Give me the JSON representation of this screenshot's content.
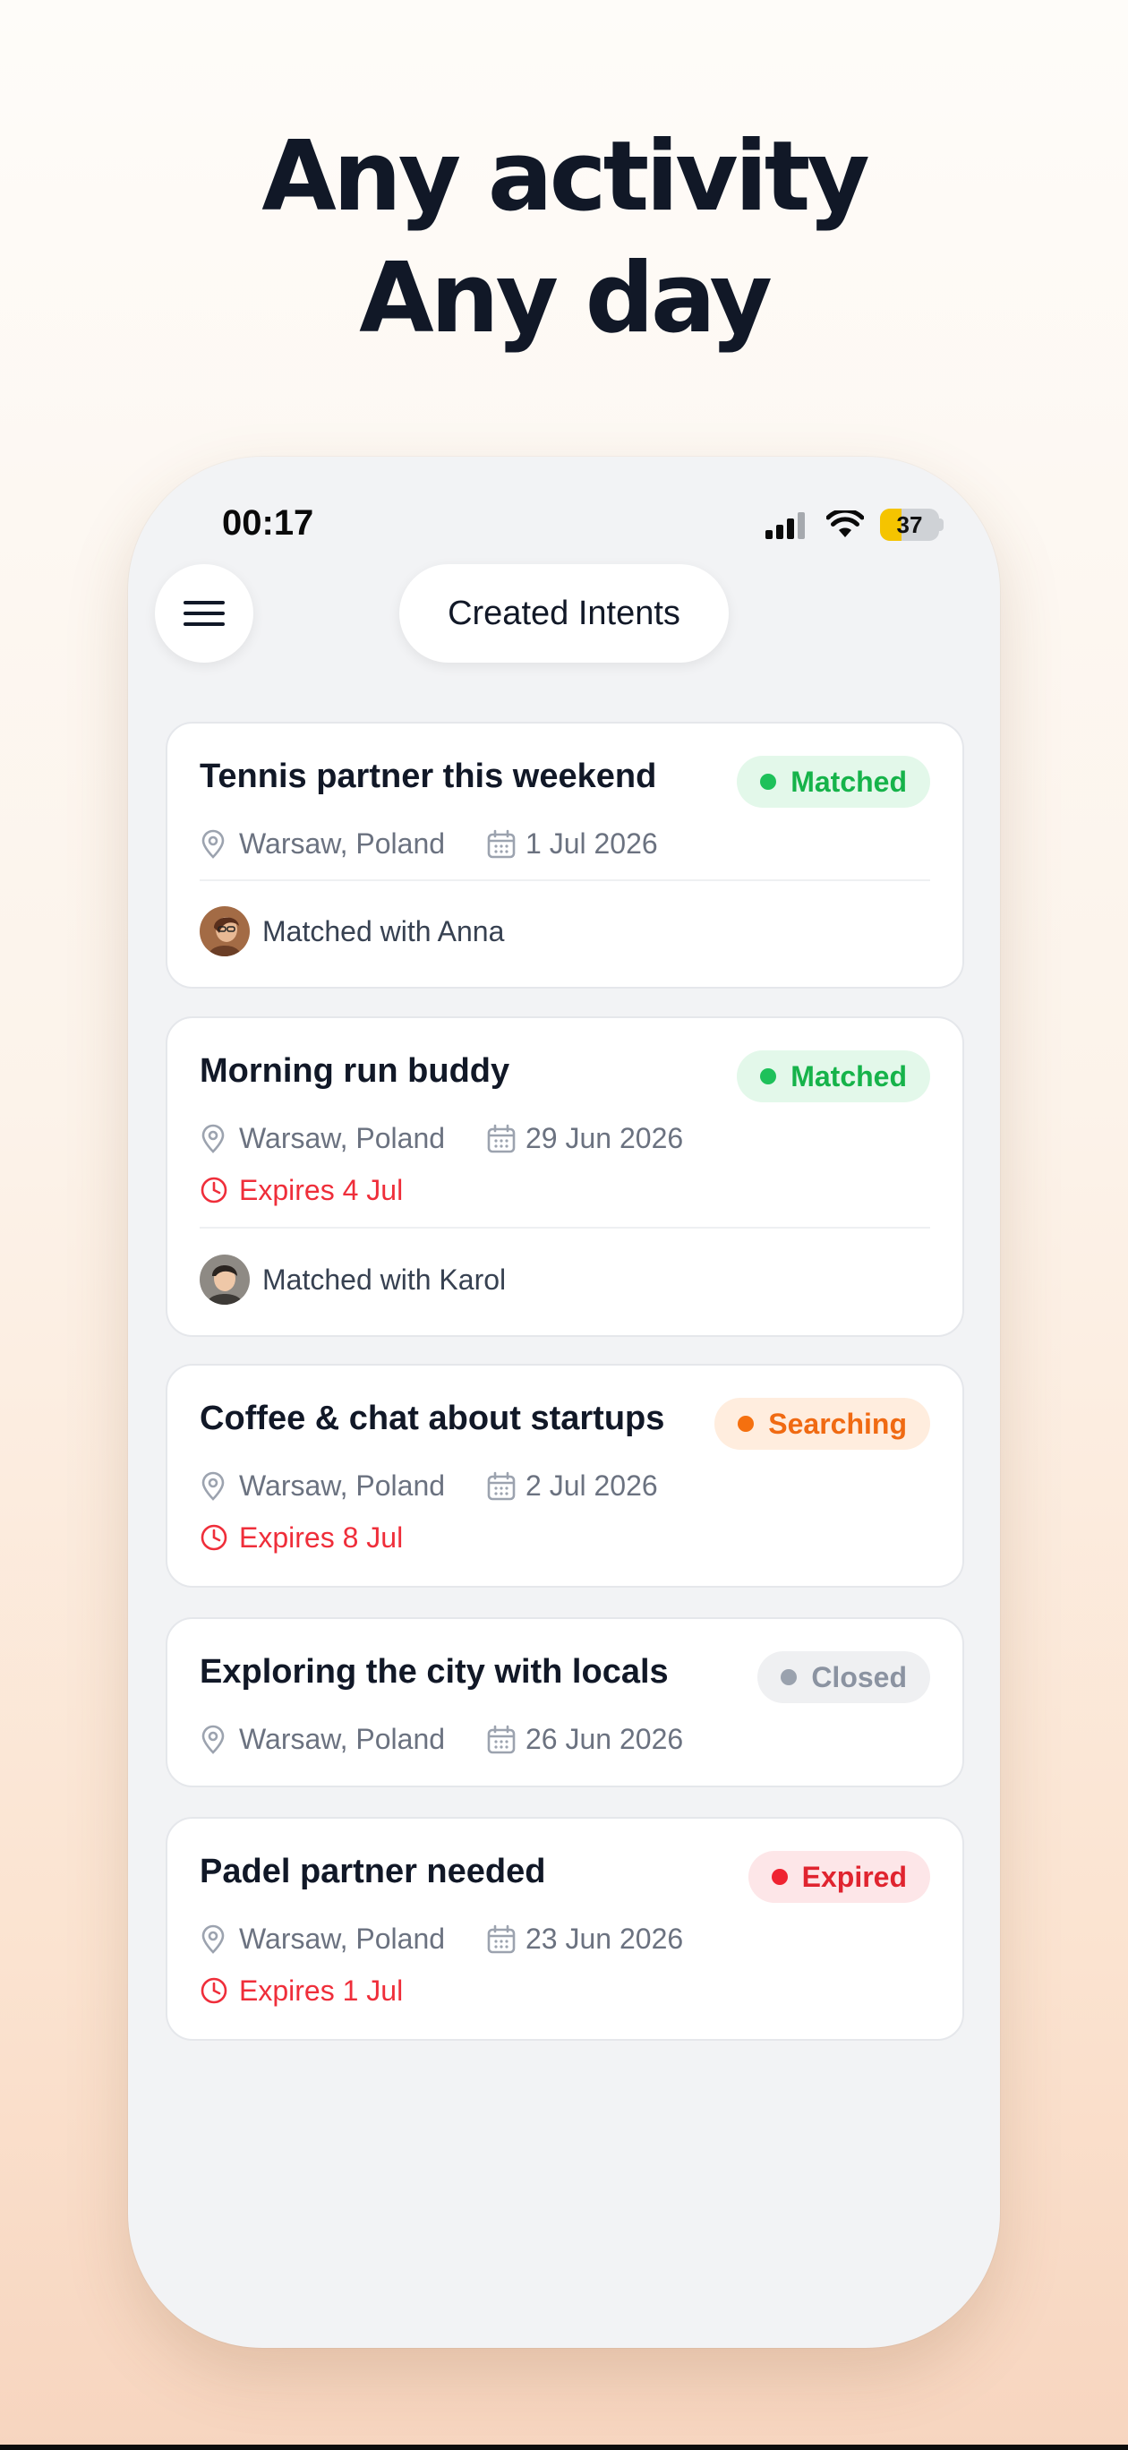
{
  "hero": {
    "line1": "Any activity",
    "line2": "Any day"
  },
  "status_bar": {
    "time": "00:17",
    "battery": "37",
    "battery_level": 0.37
  },
  "header": {
    "menu_icon": "hamburger-icon",
    "title": "Created Intents"
  },
  "intents": [
    {
      "title": "Tennis partner this weekend",
      "status": "Matched",
      "location": "Warsaw, Poland",
      "date": "1 Jul 2026",
      "expires": "",
      "matched_with": "Matched with Anna"
    },
    {
      "title": "Morning run buddy",
      "status": "Matched",
      "location": "Warsaw, Poland",
      "date": "29 Jun 2026",
      "expires": "Expires 4 Jul",
      "matched_with": "Matched with Karol"
    },
    {
      "title": "Coffee & chat about startups",
      "status": "Searching",
      "location": "Warsaw, Poland",
      "date": "2 Jul 2026",
      "expires": "Expires 8 Jul",
      "matched_with": ""
    },
    {
      "title": "Exploring the city with locals",
      "status": "Closed",
      "location": "Warsaw, Poland",
      "date": "26 Jun 2026",
      "expires": "",
      "matched_with": ""
    },
    {
      "title": "Padel partner needed",
      "status": "Expired",
      "location": "Warsaw, Poland",
      "date": "23 Jun 2026",
      "expires": "Expires 1 Jul",
      "matched_with": ""
    }
  ],
  "colors": {
    "matched": "#16b34a",
    "searching": "#f06a12",
    "closed": "#8b93a1",
    "expired": "#e0242f",
    "expires_text": "#ef2e3a"
  },
  "icons": {
    "location": "map-pin-icon",
    "date": "calendar-icon",
    "expires": "clock-icon"
  }
}
